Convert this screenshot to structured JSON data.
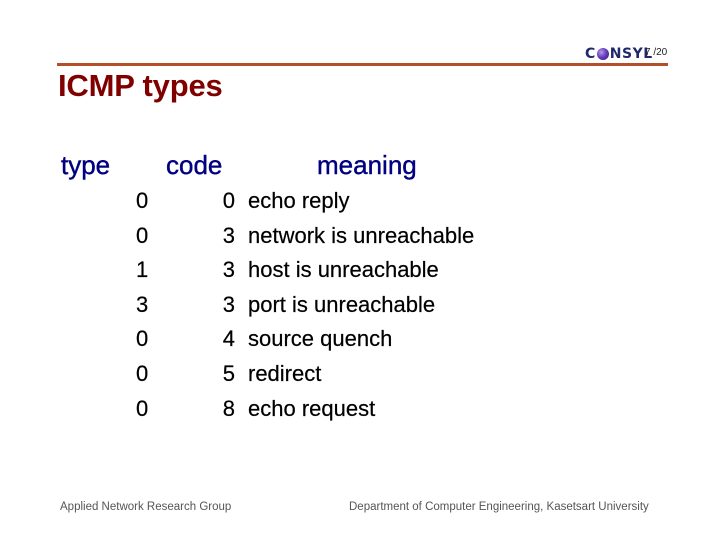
{
  "header": {
    "logo_text_prefix": "C",
    "logo_text_suffix": "NSYL",
    "logo_icon": "purple-sphere-icon",
    "page_number": "7 /20"
  },
  "title": "ICMP types",
  "table": {
    "columns": [
      "type",
      "code",
      "meaning"
    ],
    "rows": [
      {
        "type": "0",
        "code": "0",
        "meaning": "echo reply"
      },
      {
        "type": "0",
        "code": "3",
        "meaning": "network is unreachable"
      },
      {
        "type": "1",
        "code": "3",
        "meaning": "host is unreachable"
      },
      {
        "type": "3",
        "code": "3",
        "meaning": "port is unreachable"
      },
      {
        "type": "0",
        "code": "4",
        "meaning": "source quench"
      },
      {
        "type": "0",
        "code": "5",
        "meaning": "redirect"
      },
      {
        "type": "0",
        "code": "8",
        "meaning": "echo request"
      }
    ]
  },
  "footer": {
    "left": "Applied Network Research Group",
    "right": "Department of Computer Engineering, Kasetsart University"
  },
  "colors": {
    "title": "#800000",
    "header_text": "#000080",
    "rule": "#b3502a",
    "body_text": "#000000",
    "footer_text": "#555555"
  }
}
